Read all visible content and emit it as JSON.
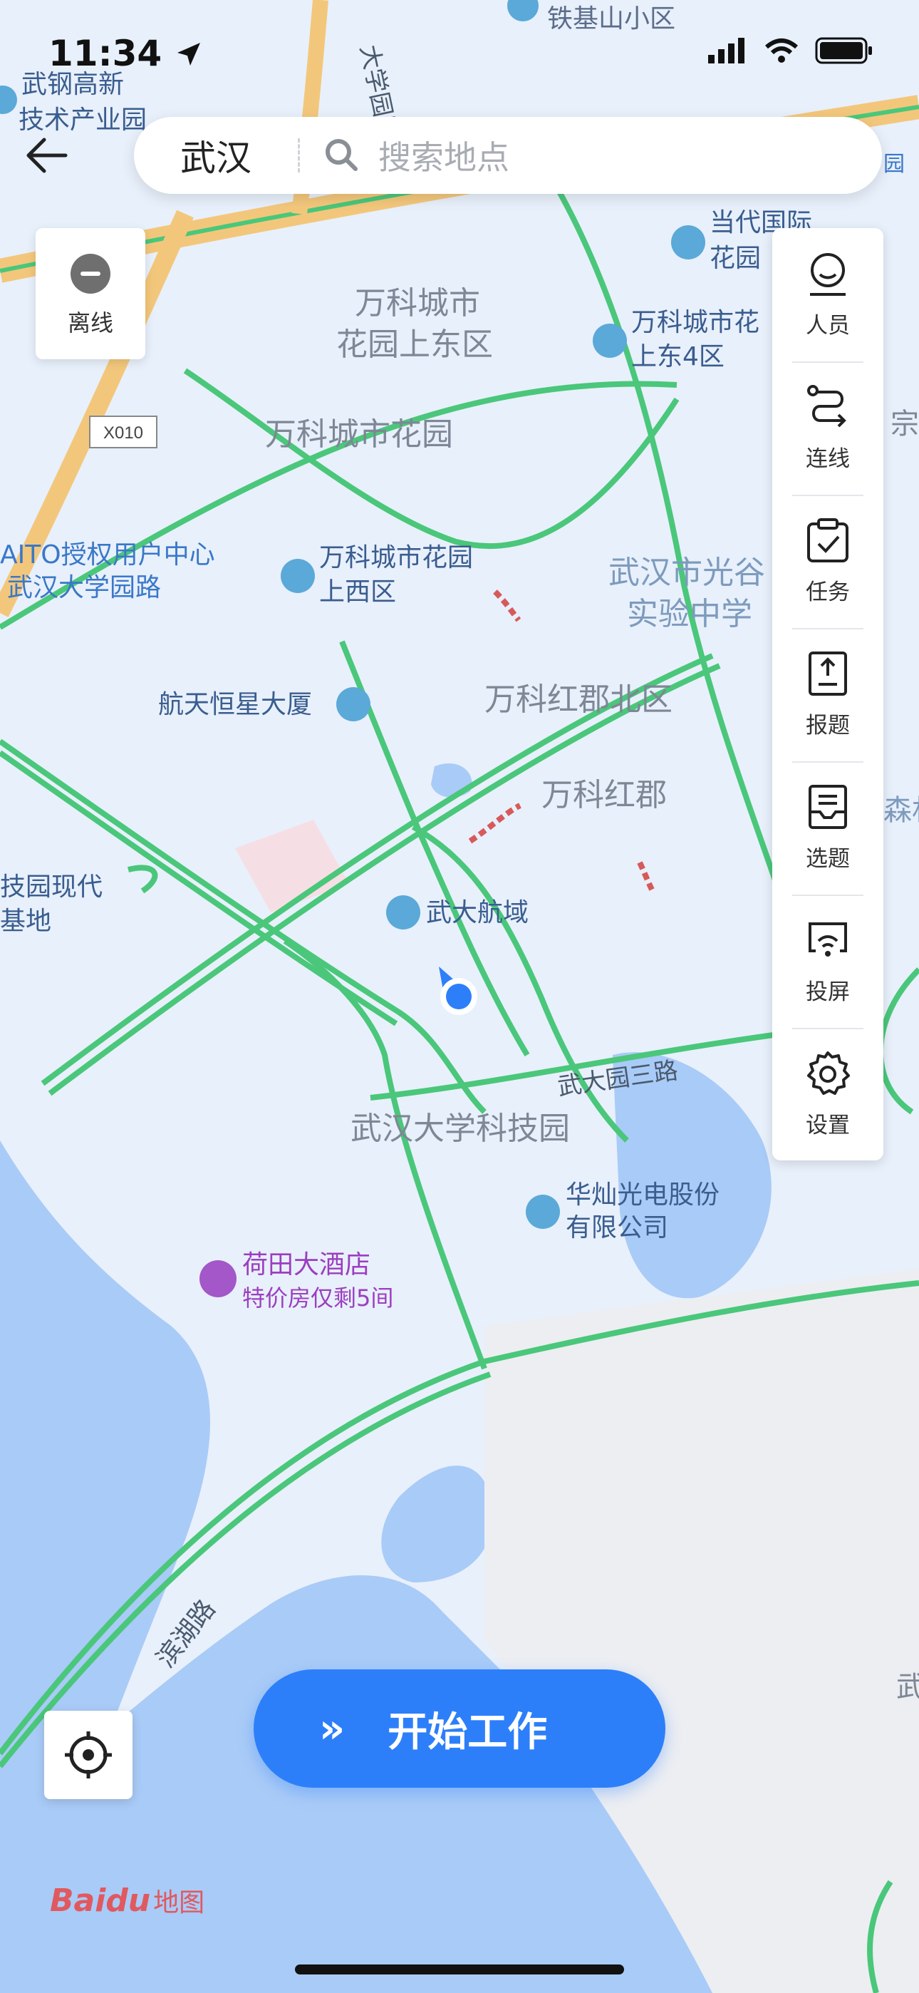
{
  "status": {
    "time": "11:34"
  },
  "search": {
    "city": "武汉",
    "placeholder": "搜索地点"
  },
  "offline": {
    "label": "离线"
  },
  "side_menu": [
    {
      "label": "人员",
      "icon": "person-icon"
    },
    {
      "label": "连线",
      "icon": "route-icon"
    },
    {
      "label": "任务",
      "icon": "clipboard-check-icon"
    },
    {
      "label": "报题",
      "icon": "upload-doc-icon"
    },
    {
      "label": "选题",
      "icon": "inbox-doc-icon"
    },
    {
      "label": "投屏",
      "icon": "cast-icon"
    },
    {
      "label": "设置",
      "icon": "gear-icon"
    }
  ],
  "start_button": {
    "chevron": "»",
    "label": "开始工作"
  },
  "map": {
    "road_shield": "X010",
    "labels": {
      "l1": "铁基山小区",
      "l2": "武钢高新",
      "l3": "技术产业园",
      "l4": "当代国际",
      "l5": "花园",
      "l6": "万科城市",
      "l7": "花园上东区",
      "l8": "万科城市花",
      "l9": "上东4区",
      "l10": "万科城市花园",
      "l11": "AITO授权用户中心",
      "l12": "武汉大学园路",
      "l13": "万科城市花园",
      "l14": "上西区",
      "l15": "武汉市光谷",
      "l16": "实验中学",
      "l17": "航天恒星大厦",
      "l18": "万科红郡北区",
      "l19": "万科红郡",
      "l20": "技园现代",
      "l21": "基地",
      "l22": "武大航域",
      "l23": "武大园三路",
      "l24": "武汉大学科技园",
      "l25": "华灿光电股份",
      "l26": "有限公司",
      "l27": "荷田大酒店",
      "l28": "特价房仅剩5间",
      "l29": "滨湖路",
      "l30": "大学园路",
      "l31": "森林",
      "l32": "宗花",
      "l33": "武",
      "l34": "园"
    }
  },
  "logo": {
    "text": "Baidu",
    "sub": "地图"
  }
}
